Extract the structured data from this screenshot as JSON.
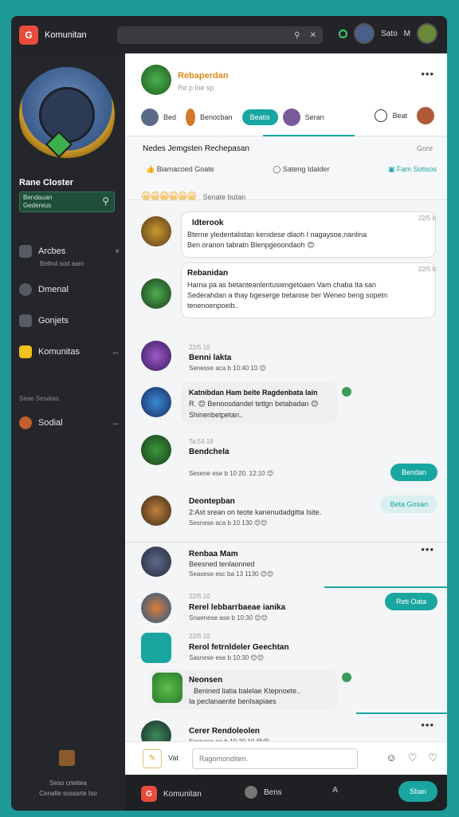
{
  "app": {
    "title": "Komunitan"
  },
  "topbar": {
    "search_placeholder": "",
    "search_icon": "search-icon",
    "close_icon": "close-icon",
    "user_name": "Sato",
    "user_initial": "M"
  },
  "sidebar": {
    "profile_name": "Rane Closter",
    "panel_line1": "Bendauan",
    "panel_line2": "Gedereus",
    "nav": [
      {
        "label": "Arcbes",
        "sub": "Bellnd sod aam",
        "right": "×"
      },
      {
        "label": "Dmenal"
      },
      {
        "label": "Gonjets"
      },
      {
        "label": "Komunitas",
        "right": "↔"
      },
      {
        "label": "Sodial",
        "right": "↔"
      }
    ],
    "section_label": "Seae Sesatas",
    "footer_line1": "Seso crteitea",
    "footer_line2": "Cenalte sosssrte tso"
  },
  "post": {
    "title": "Rebaperdan",
    "subtitle": "Re p loe sp",
    "more": "•••",
    "tabs": [
      {
        "label": "Bed"
      },
      {
        "label": "Benocban"
      },
      {
        "label": "Beatis",
        "active": true
      },
      {
        "label": "Seran"
      }
    ],
    "right_tab": "Beat"
  },
  "meta": {
    "title": "Nedes Jemgsten Rechepasan",
    "right": "Gore",
    "action1": "Biamacoed Goate",
    "action2": "Sateng Idalder",
    "action3": "Fam Sotisos",
    "emojis": "😀😀😀😀😀😀",
    "emoji_label": "Senate butan"
  },
  "messages": [
    {
      "name": "Idterook",
      "text1": "Bterne yledentalistan kenidese dlaoh I nagaysoe,nanlina",
      "text2": "Ben oranon tabratn Blenpgeoondaoh 😊",
      "time": "22/5 b"
    },
    {
      "name": "Rebanidan",
      "text1": "Harna pa as betanteanlentusiengetoaen Vam chaba Ita san",
      "text2": "Sederahdan a thay bgeserge betanise ber Weneo beng sopetn",
      "text3": "tenenoenpoeib..",
      "time": "22/5 b"
    },
    {
      "name": "Benni lakta",
      "small": "22/5 10",
      "sub": "Senesse aca b 10:40 10 😊"
    },
    {
      "name": "Katnibdan Ham beite Ragdenbata lain",
      "text1": "R. 😊 Benoosdandel tetlgn betabadan 😊",
      "text2": "Shinenbetpetan.."
    },
    {
      "name": "Bendchela",
      "small": "Ta:54 18",
      "sub": "Sesene ese b 10 20. 12:10 😊",
      "pill": "Bendan"
    },
    {
      "name": "Deontepban",
      "text1": "2:Ast srean on teote kanenudadgitta Isite.",
      "sub": "Sesnese aca b 10 130 😊😊",
      "pill": "Beta Gosan"
    },
    {
      "name": "Renbaa Mam",
      "text1": "Beesned tenlaonned",
      "sub": "Seasese esc ba 13 1130 😊😊",
      "more": "•••"
    },
    {
      "name": "Rerel lebbarrbaeae ianika",
      "small": "22/5 10",
      "sub": "Snaenese ase b 10:30 😊😊",
      "pill": "Reti Oata"
    },
    {
      "name": "Rerol fetrnldeler Geechtan",
      "small": "22/5 10",
      "sub": "Sasnese ese b 10:30 😊😊"
    },
    {
      "name": "Neonsen",
      "text1": "Benined liatia balelae Ktepnoete..",
      "text2": "Ia peclanaente benlsapiaes"
    },
    {
      "name": "Cerer Rendoleolen",
      "sub": "Sesnase ao b 10 20 10 😊😊",
      "more": "•••"
    }
  ],
  "composer": {
    "label": "Vat",
    "placeholder": "Ragomonditen."
  },
  "bottombar": {
    "home": "Komunitan",
    "mid": "Bens",
    "pill": "Sban"
  }
}
